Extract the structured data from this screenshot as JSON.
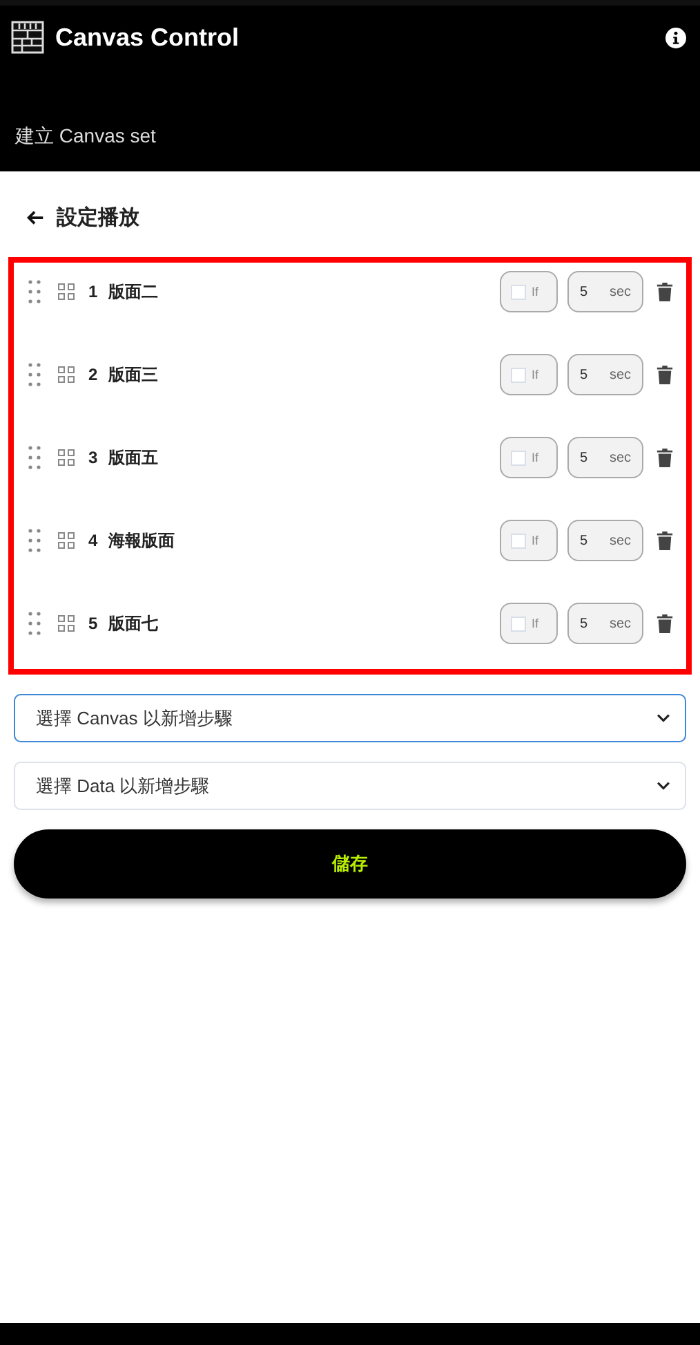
{
  "app_bar": {
    "title": "Canvas Control",
    "subtitle": "建立 Canvas set"
  },
  "page": {
    "title": "設定播放"
  },
  "steps": [
    {
      "number": "1",
      "name": "版面二",
      "if_checked": false,
      "if_label": "If",
      "seconds": "5",
      "unit": "sec"
    },
    {
      "number": "2",
      "name": "版面三",
      "if_checked": false,
      "if_label": "If",
      "seconds": "5",
      "unit": "sec"
    },
    {
      "number": "3",
      "name": "版面五",
      "if_checked": false,
      "if_label": "If",
      "seconds": "5",
      "unit": "sec"
    },
    {
      "number": "4",
      "name": "海報版面",
      "if_checked": false,
      "if_label": "If",
      "seconds": "5",
      "unit": "sec"
    },
    {
      "number": "5",
      "name": "版面七",
      "if_checked": false,
      "if_label": "If",
      "seconds": "5",
      "unit": "sec"
    }
  ],
  "selects": [
    {
      "placeholder": "選擇 Canvas 以新增步驟",
      "focused": true
    },
    {
      "placeholder": "選擇 Data 以新增步驟",
      "focused": false
    }
  ],
  "save_button": "儲存"
}
